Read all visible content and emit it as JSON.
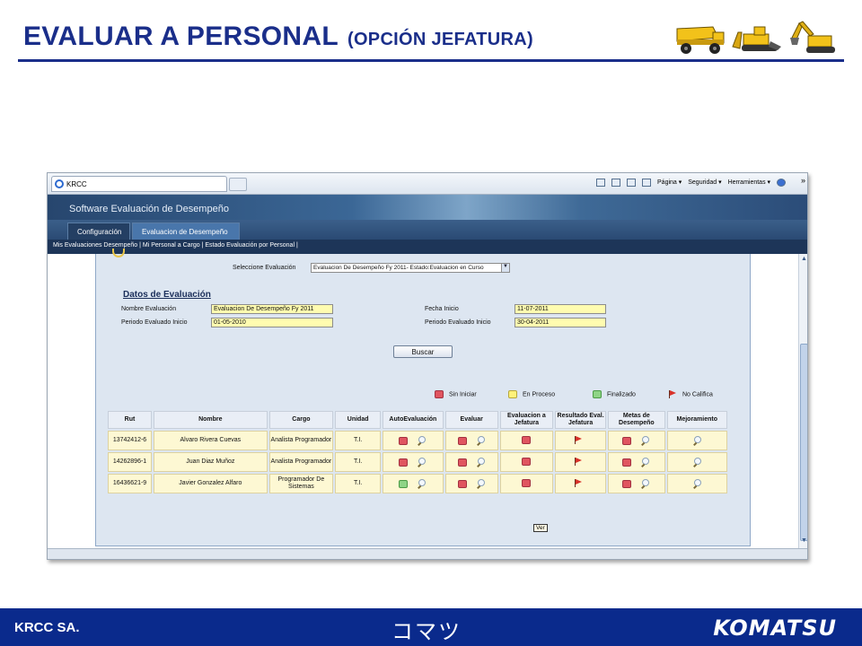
{
  "slide": {
    "title": "EVALUAR A PERSONAL",
    "subtitle": "(OPCIÓN JEFATURA)",
    "footer_left": "KRCC SA.",
    "footer_center": "コマツ",
    "footer_right": "KOMATSU"
  },
  "browser": {
    "tab_title": "KRCC",
    "commands": [
      "Página ▾",
      "Seguridad ▾",
      "Herramientas ▾"
    ],
    "chevron": "»"
  },
  "app": {
    "title": "Software Evaluación de Desempeño",
    "tabs": [
      {
        "label": "Configuración",
        "active": false
      },
      {
        "label": "Evaluacion de Desempeño",
        "active": true
      }
    ],
    "subnav": "Mis Evaluaciones Desempeño | Mi Personal a Cargo | Estado Evaluación por Personal |",
    "select_label": "Seleccione Evaluación",
    "select_value": "Evaluacion De Desempeño Fy 2011- Estado:Evaluacion en Curso",
    "section_title": "Datos de Evaluación",
    "fields": {
      "nombre_label": "Nombre Evaluación",
      "nombre_value": "Evaluacion De Desempeño Fy 2011",
      "fecha_label": "Fecha Inicio",
      "fecha_value": "11-07-2011",
      "periodo_inicio_label": "Periodo Evaluado Inicio",
      "periodo_inicio_value": "01-05-2010",
      "periodo_fin_label": "Periodo Evaluado Inicio",
      "periodo_fin_value": "30-04-2011"
    },
    "search_button": "Buscar",
    "legend": {
      "sin_iniciar": "Sin Iniciar",
      "en_proceso": "En Proceso",
      "finalizado": "Finalizado",
      "no_califica": "No Califica"
    },
    "table": {
      "headers": [
        "Rut",
        "Nombre",
        "Cargo",
        "Unidad",
        "AutoEvaluación",
        "Evaluar",
        "Evaluacion a Jefatura",
        "Resultado Eval. Jefatura",
        "Metas de Desempeño",
        "Mejoramiento"
      ],
      "rows": [
        {
          "rut": "13742412-6",
          "nombre": "Alvaro Rivera Cuevas",
          "cargo": "Analista Programador",
          "unidad": "T.I.",
          "auto": "red",
          "evaluar": "red",
          "jefatura": "red",
          "metas": "red"
        },
        {
          "rut": "14262896-1",
          "nombre": "Juan Diaz Muñoz",
          "cargo": "Analista Programador",
          "unidad": "T.I.",
          "auto": "red",
          "evaluar": "red",
          "jefatura": "red",
          "metas": "red"
        },
        {
          "rut": "16436621-9",
          "nombre": "Javier Gonzalez Alfaro",
          "cargo": "Programador De Sistemas",
          "unidad": "T.I.",
          "auto": "green",
          "evaluar": "red",
          "jefatura": "red",
          "metas": "red"
        }
      ]
    },
    "tooltip": "Ver"
  },
  "colors": {
    "brand_blue": "#1a2e8a",
    "footer_blue": "#0a2a8c",
    "status_red": "#e05560",
    "status_yellow": "#fff27a",
    "status_green": "#8ed486"
  }
}
